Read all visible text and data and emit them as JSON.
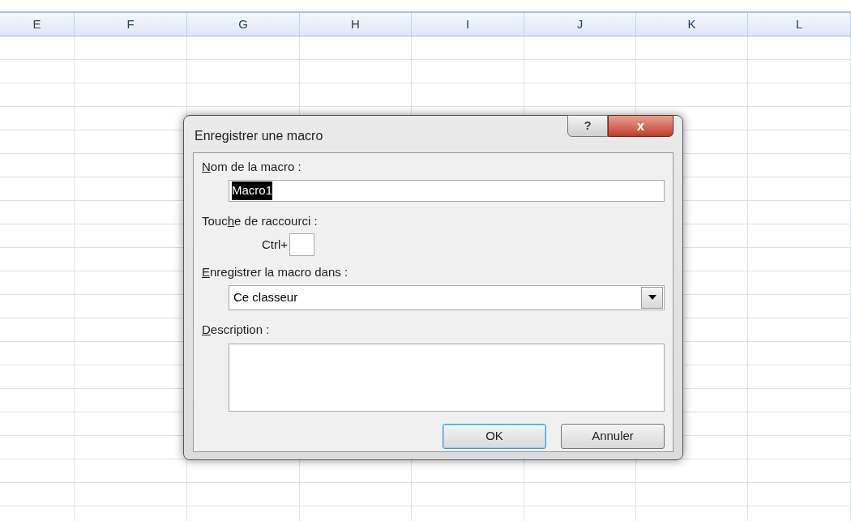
{
  "sheet": {
    "columns": [
      "E",
      "F",
      "G",
      "H",
      "I",
      "J",
      "K",
      "L"
    ]
  },
  "dialog": {
    "title": "Enregistrer une macro",
    "help_button": "?",
    "close_button": "x",
    "name_field": {
      "label_parts": [
        {
          "text": "N",
          "underline": true
        },
        {
          "text": "om de la macro :",
          "underline": false
        }
      ],
      "value": "Macro1",
      "selected": true
    },
    "shortcut": {
      "label_parts": [
        {
          "text": "Touc",
          "underline": false
        },
        {
          "text": "h",
          "underline": true
        },
        {
          "text": "e de raccourci :",
          "underline": false
        }
      ],
      "prefix": "Ctrl+"
    },
    "store_in": {
      "label_parts": [
        {
          "text": "E",
          "underline": true
        },
        {
          "text": "nregistrer la macro dans :",
          "underline": false
        }
      ],
      "value": "Ce classeur"
    },
    "description": {
      "label_parts": [
        {
          "text": "D",
          "underline": true
        },
        {
          "text": "escription :",
          "underline": false
        }
      ]
    },
    "buttons": [
      {
        "label": "OK",
        "default": true
      },
      {
        "label": "Annuler",
        "default": false
      }
    ]
  }
}
